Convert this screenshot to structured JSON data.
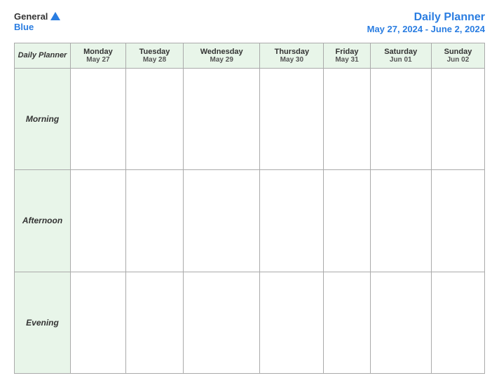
{
  "header": {
    "logo": {
      "general": "General",
      "blue": "Blue",
      "triangle_color": "#2a7de1"
    },
    "title": "Daily Planner",
    "date_range": "May 27, 2024 - June 2, 2024"
  },
  "table": {
    "label_header": "Daily Planner",
    "days": [
      {
        "name": "Monday",
        "date": "May 27"
      },
      {
        "name": "Tuesday",
        "date": "May 28"
      },
      {
        "name": "Wednesday",
        "date": "May 29"
      },
      {
        "name": "Thursday",
        "date": "May 30"
      },
      {
        "name": "Friday",
        "date": "May 31"
      },
      {
        "name": "Saturday",
        "date": "Jun 01"
      },
      {
        "name": "Sunday",
        "date": "Jun 02"
      }
    ],
    "rows": [
      {
        "label": "Morning"
      },
      {
        "label": "Afternoon"
      },
      {
        "label": "Evening"
      }
    ]
  }
}
